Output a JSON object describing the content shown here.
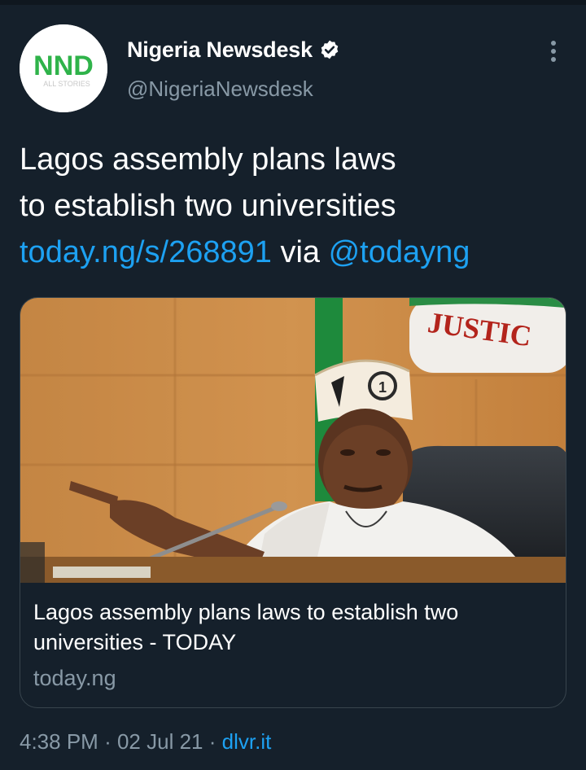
{
  "account": {
    "display_name": "Nigeria Newsdesk",
    "handle": "@NigeriaNewsdesk",
    "avatar_logo": "NND",
    "avatar_subtext": "ALL STORIES",
    "verified_icon": "verified-badge-icon"
  },
  "tweet": {
    "line1": "Lagos assembly plans laws",
    "line2": "to establish two universities",
    "link_url": "today.ng/s/268891",
    "via_word": "via",
    "mention": "@todayng"
  },
  "card": {
    "image_sign_text": "JUSTIC",
    "image_cap_badge": "1",
    "title": "Lagos assembly plans laws to establish two universities - TODAY",
    "domain": "today.ng"
  },
  "meta": {
    "time": "4:38 PM",
    "sep1": "·",
    "date": "02 Jul 21",
    "sep2": "·",
    "source": "dlvr.it"
  },
  "colors": {
    "background": "#15202b",
    "link": "#1da1f2",
    "muted": "#8899a6",
    "border": "#38444d",
    "logo_green": "#2fb34a"
  }
}
